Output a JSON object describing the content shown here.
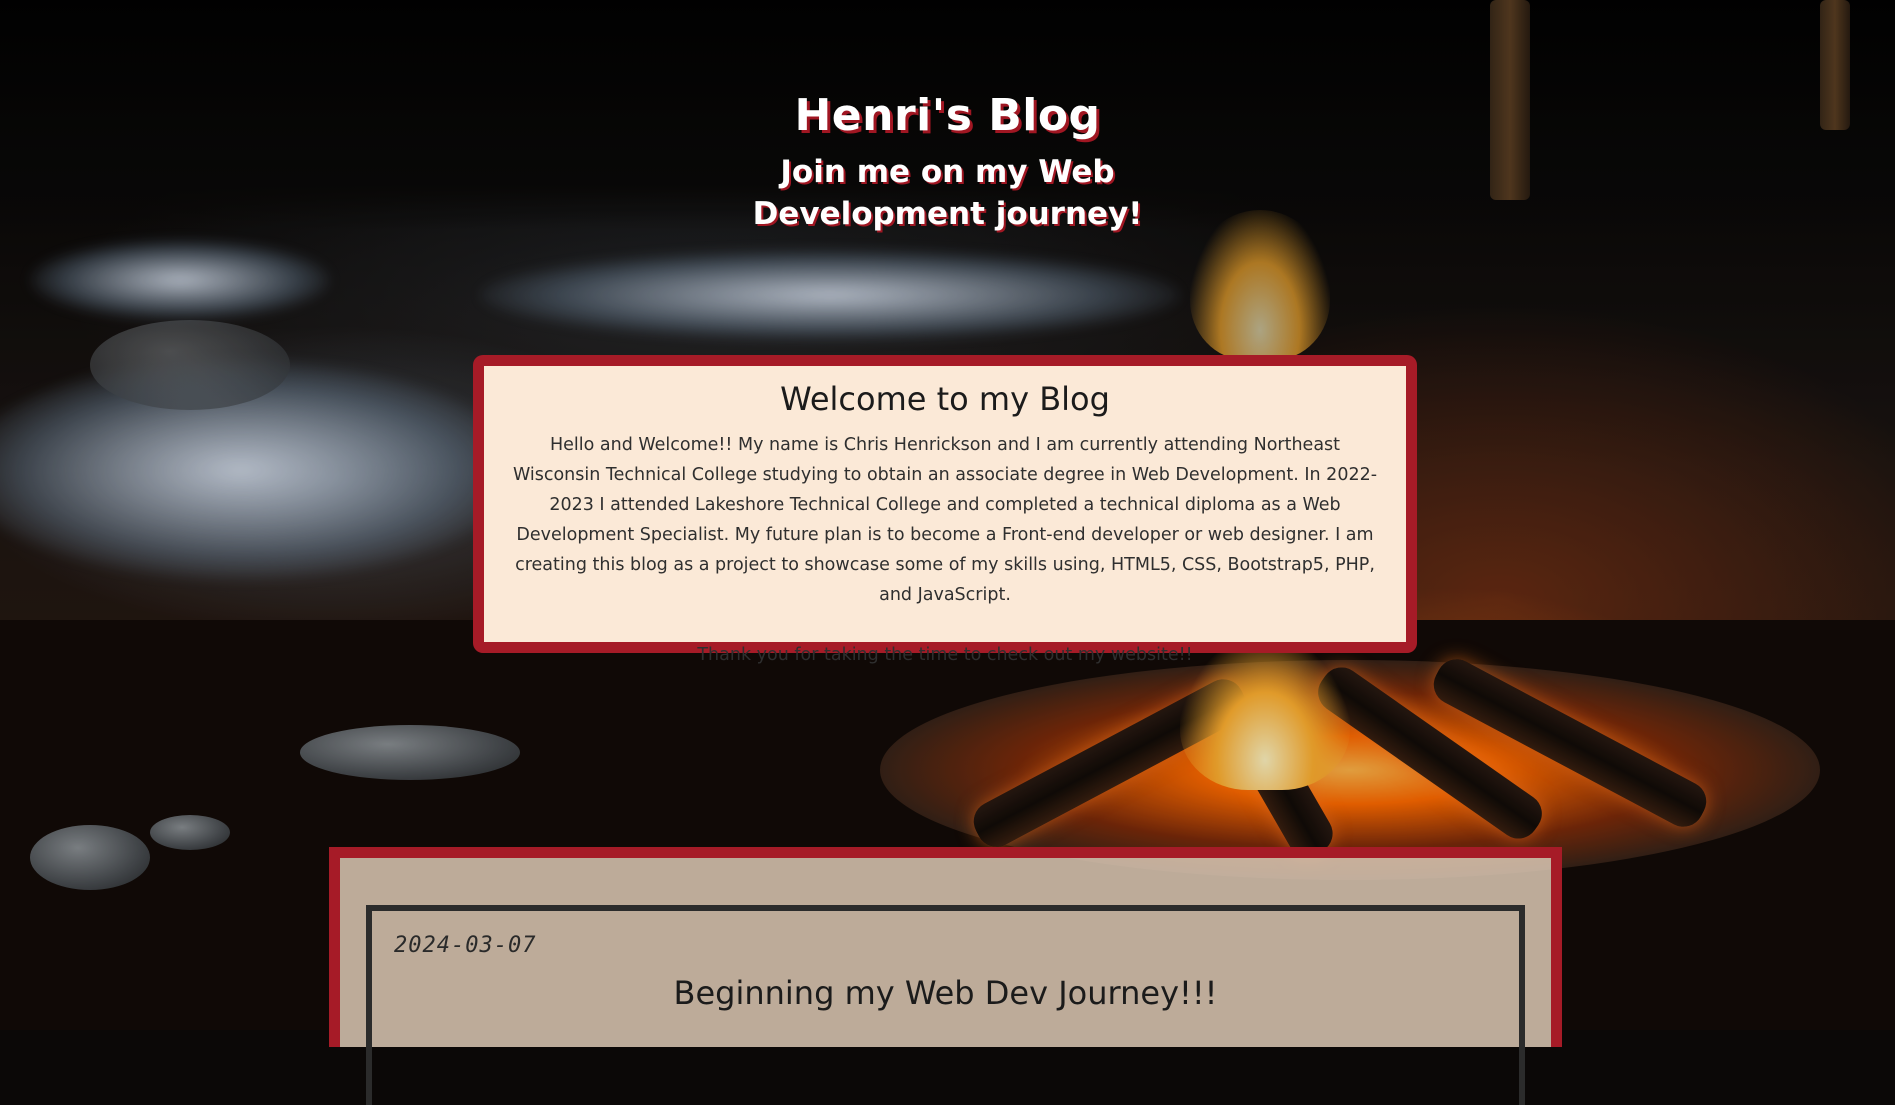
{
  "header": {
    "title": "Henri's Blog",
    "subtitle": "Join me on my Web Development journey!"
  },
  "welcome": {
    "heading": "Welcome to my Blog",
    "body": "Hello and Welcome!! My name is Chris Henrickson and I am currently attending Northeast Wisconsin Technical College studying to obtain an associate degree in Web Development. In 2022-2023 I attended Lakeshore Technical College and completed a technical diploma as a Web Development Specialist. My future plan is to become a Front-end developer or web designer. I am creating this blog as a project to showcase some of my skills using, HTML5, CSS, Bootstrap5, PHP, and JavaScript.",
    "thanks": "Thank you for taking the time to check out my website!!"
  },
  "posts": [
    {
      "date": "2024-03-07",
      "title": "Beginning my Web Dev Journey!!!"
    }
  ],
  "colors": {
    "accent": "#a61b27",
    "card_background": "#fbe9d7",
    "post_section_background": "#dcc8b4",
    "post_border": "#2b2b2b"
  }
}
